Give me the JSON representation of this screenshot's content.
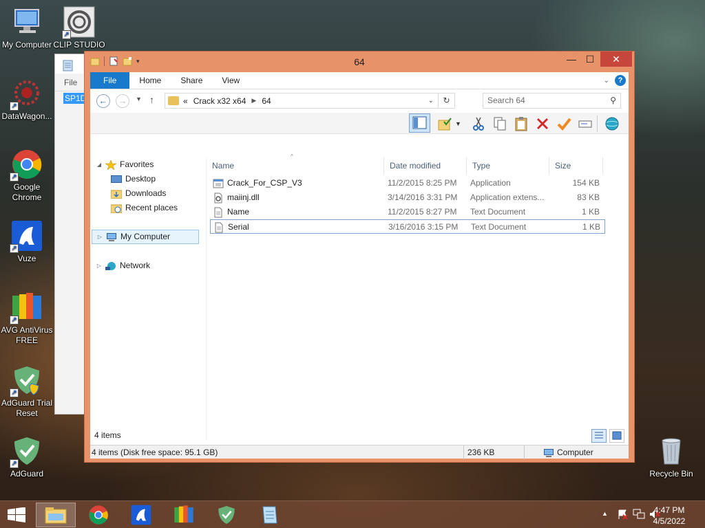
{
  "desktop": {
    "icons": [
      {
        "label": "My Computer"
      },
      {
        "label": "CLIP STUDIO"
      },
      {
        "label": "DataWagon..."
      },
      {
        "label": "Google Chrome"
      },
      {
        "label": "Vuze"
      },
      {
        "label": "AVG AntiVirus FREE"
      },
      {
        "label": "AdGuard Trial Reset"
      },
      {
        "label": "AdGuard"
      },
      {
        "label": "Recycle Bin"
      }
    ]
  },
  "background_window": {
    "menu_label": "File",
    "selected_text": "SP1D"
  },
  "explorer": {
    "title": "64",
    "tabs": [
      {
        "label": "File"
      },
      {
        "label": "Home"
      },
      {
        "label": "Share"
      },
      {
        "label": "View"
      }
    ],
    "address": {
      "overflow": "«",
      "crumbs": [
        "Crack x32 x64",
        "64"
      ],
      "separator": "▶"
    },
    "search": {
      "placeholder": "Search 64"
    },
    "nav": {
      "favorites": "Favorites",
      "desktop": "Desktop",
      "downloads": "Downloads",
      "recent": "Recent places",
      "computer": "My Computer",
      "network": "Network"
    },
    "columns": {
      "name": "Name",
      "date": "Date modified",
      "type": "Type",
      "size": "Size"
    },
    "files": [
      {
        "name": "Crack_For_CSP_V3",
        "date": "11/2/2015 8:25 PM",
        "type": "Application",
        "size": "154 KB",
        "icon": "app-icon"
      },
      {
        "name": "maiinj.dll",
        "date": "3/14/2016 3:31 PM",
        "type": "Application extens...",
        "size": "83 KB",
        "icon": "dll-icon"
      },
      {
        "name": "Name",
        "date": "11/2/2015 8:27 PM",
        "type": "Text Document",
        "size": "1 KB",
        "icon": "text-file-icon"
      },
      {
        "name": "Serial",
        "date": "3/16/2016 3:15 PM",
        "type": "Text Document",
        "size": "1 KB",
        "icon": "text-file-icon"
      }
    ],
    "item_count": "4 items",
    "status": {
      "left": "4 items (Disk free space: 95.1 GB)",
      "middle": "236 KB",
      "right": "Computer"
    }
  },
  "taskbar": {
    "clock_time": "4:47 PM",
    "clock_date": "4/5/2022"
  }
}
